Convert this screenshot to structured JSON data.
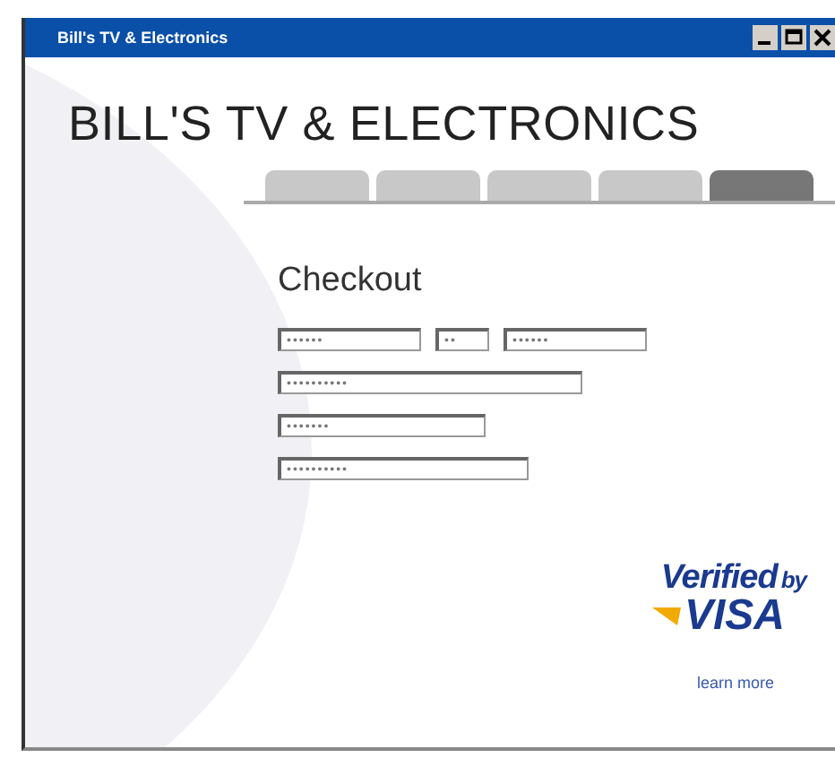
{
  "window": {
    "title": "Bill's TV & Electronics"
  },
  "header": {
    "title": "BILL'S TV & ELECTRONICS"
  },
  "tabs": [
    {
      "selected": false
    },
    {
      "selected": false
    },
    {
      "selected": false
    },
    {
      "selected": false
    },
    {
      "selected": true
    }
  ],
  "checkout": {
    "heading": "Checkout",
    "rows": [
      [
        {
          "value": "••••••"
        },
        {
          "value": "••"
        },
        {
          "value": "••••••"
        }
      ],
      [
        {
          "value": "••••••••••"
        }
      ],
      [
        {
          "value": "•••••••"
        }
      ],
      [
        {
          "value": "••••••••••"
        }
      ]
    ]
  },
  "badge": {
    "line_1": "Verified",
    "line_1_small": "by",
    "line_2": "VISA",
    "link": "learn more"
  }
}
